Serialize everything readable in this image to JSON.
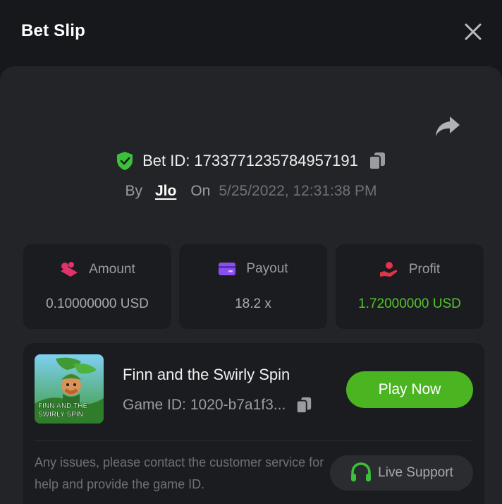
{
  "header": {
    "title": "Bet Slip"
  },
  "bet": {
    "id_label": "Bet ID:",
    "id_value": "1733771235784957191",
    "by_label": "By",
    "user": "Jlo",
    "on_label": "On",
    "date": "5/25/2022, 12:31:38 PM"
  },
  "stats": {
    "amount_label": "Amount",
    "amount_value": "0.10000000 USD",
    "payout_label": "Payout",
    "payout_value": "18.2 x",
    "profit_label": "Profit",
    "profit_value": "1.72000000 USD"
  },
  "game": {
    "thumb_text_line1": "FINN AND THE",
    "thumb_text_line2": "SWIRLY SPIN",
    "name": "Finn and the Swirly Spin",
    "id_label": "Game ID:",
    "id_value": "1020-b7a1f3...",
    "play_label": "Play Now"
  },
  "support": {
    "text": "Any issues, please contact the customer service for help and provide the game ID.",
    "button_label": "Live Support"
  },
  "colors": {
    "background": "#17181b",
    "panel": "#232427",
    "card": "#1b1c1f",
    "accent_green": "#4bb521",
    "profit_green": "#55c32e",
    "amount_pink": "#e0336b",
    "payout_purple": "#8a4ff0",
    "profit_red": "#e0344a"
  },
  "icons": {
    "close": "close-icon",
    "share": "share-icon",
    "shield": "shield-check-icon",
    "copy": "copy-icon",
    "amount": "coins-icon",
    "payout": "card-icon",
    "profit": "hand-coin-icon",
    "support": "headset-icon"
  }
}
